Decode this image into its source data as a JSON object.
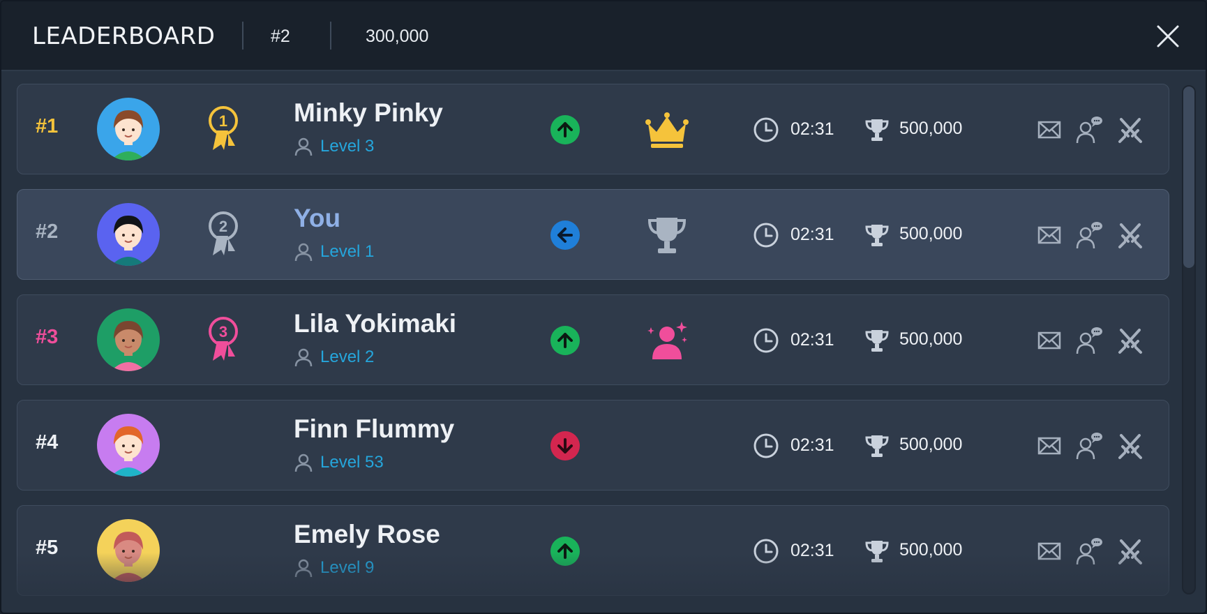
{
  "header": {
    "title": "LEADERBOARD",
    "my_rank": "#2",
    "my_score": "300,000",
    "close_icon": "close-icon"
  },
  "colors": {
    "gold": "#f5c33b",
    "silver": "#a9b4c2",
    "pink": "#f04e9b",
    "level_text": "#25a6dc",
    "trend_up": "#19b35a",
    "trend_same": "#1f7fd9",
    "trend_down": "#d3264f"
  },
  "rows": [
    {
      "rank": "#1",
      "rank_color": "#f5c33b",
      "avatar": "avatar-girl-brown-hair",
      "medal": "gold-medal-icon",
      "name": "Minky Pinky",
      "level": "Level 3",
      "trend": "up",
      "badge": "crown-icon",
      "time": "02:31",
      "score": "500,000",
      "current_user": false
    },
    {
      "rank": "#2",
      "rank_color": "#a9b4c2",
      "avatar": "avatar-boy-black-hair",
      "medal": "silver-medal-icon",
      "name": "You",
      "level": "Level 1",
      "trend": "same",
      "badge": "trophy-icon",
      "time": "02:31",
      "score": "500,000",
      "current_user": true
    },
    {
      "rank": "#3",
      "rank_color": "#f04e9b",
      "avatar": "avatar-girl-pigtails",
      "medal": "pink-medal-icon",
      "name": "Lila Yokimaki",
      "level": "Level 2",
      "trend": "up",
      "badge": "sparkle-person-icon",
      "time": "02:31",
      "score": "500,000",
      "current_user": false
    },
    {
      "rank": "#4",
      "rank_color": "#eef1f5",
      "avatar": "avatar-boy-orange-hair",
      "medal": "",
      "name": "Finn Flummy",
      "level": "Level 53",
      "trend": "down",
      "badge": "",
      "time": "02:31",
      "score": "500,000",
      "current_user": false
    },
    {
      "rank": "#5",
      "rank_color": "#eef1f5",
      "avatar": "avatar-girl-red-hair",
      "medal": "",
      "name": "Emely Rose",
      "level": "Level 9",
      "trend": "up",
      "badge": "",
      "time": "02:31",
      "score": "500,000",
      "current_user": false
    }
  ],
  "row_actions": [
    "mail-icon",
    "friend-chat-icon",
    "crossed-swords-icon"
  ]
}
